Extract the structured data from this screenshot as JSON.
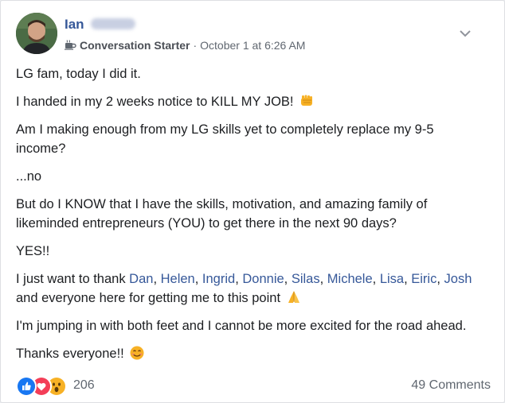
{
  "post": {
    "author": {
      "name": "Ian",
      "avatar_icon": "profile-photo"
    },
    "badge": {
      "icon": "coffee-cup-icon",
      "label": "Conversation Starter"
    },
    "separator": "·",
    "timestamp": "October 1 at 6:26 AM",
    "menu_icon": "chevron-down-icon",
    "paragraphs": {
      "p1": "LG fam, today I did it.",
      "p2": "I handed in my 2 weeks notice to KILL MY JOB!",
      "p2_emoji": "fist-emoji",
      "p3": "Am I making enough from my LG skills yet to completely replace my 9-5 income?",
      "p4": "...no",
      "p5": "But do I KNOW that I have the skills, motivation, and amazing family of likeminded entrepreneurs (YOU) to get there in the next 90 days?",
      "p6": "YES!!",
      "p7_intro": "I just want to thank ",
      "p7_outro": " and everyone here for getting me to this point",
      "p7_emoji": "folded-hands-emoji",
      "p8": "I'm jumping in with both feet and I cannot be more excited for the road ahead.",
      "p9": "Thanks everyone!!",
      "p9_emoji": "smiling-face-emoji"
    },
    "tags": [
      "Dan",
      "Helen",
      "Ingrid",
      "Donnie",
      "Silas",
      "Michele",
      "Lisa",
      "Eiric",
      "Josh"
    ],
    "tag_separator": ", ",
    "footer": {
      "reactions": [
        "like-icon",
        "love-icon",
        "wow-icon"
      ],
      "reaction_count": "206",
      "comments": "49 Comments"
    },
    "colors": {
      "link": "#365899",
      "text": "#1c1e21",
      "muted": "#606770",
      "like": "#1877f2",
      "love": "#f33e58",
      "wow": "#f7b125"
    }
  }
}
